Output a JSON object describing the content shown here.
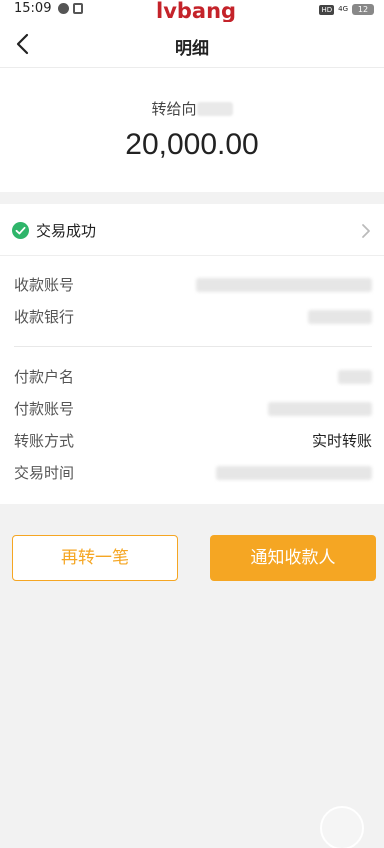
{
  "status_bar": {
    "time": "15:09",
    "watermark": "lvbang",
    "hd_badge": "HD",
    "network": "4G",
    "battery": "12"
  },
  "nav": {
    "title": "明细"
  },
  "transfer": {
    "recipient_prefix": "转给向",
    "amount": "20,000.00"
  },
  "transaction": {
    "status_text": "交易成功"
  },
  "receiver_info": [
    {
      "label": "收款账号"
    },
    {
      "label": "收款银行"
    }
  ],
  "payer_info": [
    {
      "label": "付款户名"
    },
    {
      "label": "付款账号"
    },
    {
      "label": "转账方式",
      "value": "实时转账"
    },
    {
      "label": "交易时间"
    }
  ],
  "actions": {
    "retransfer_label": "再转一笔",
    "notify_label": "通知收款人"
  },
  "colors": {
    "accent": "#f5a623",
    "success": "#2fb56a",
    "watermark": "#c4232a"
  }
}
